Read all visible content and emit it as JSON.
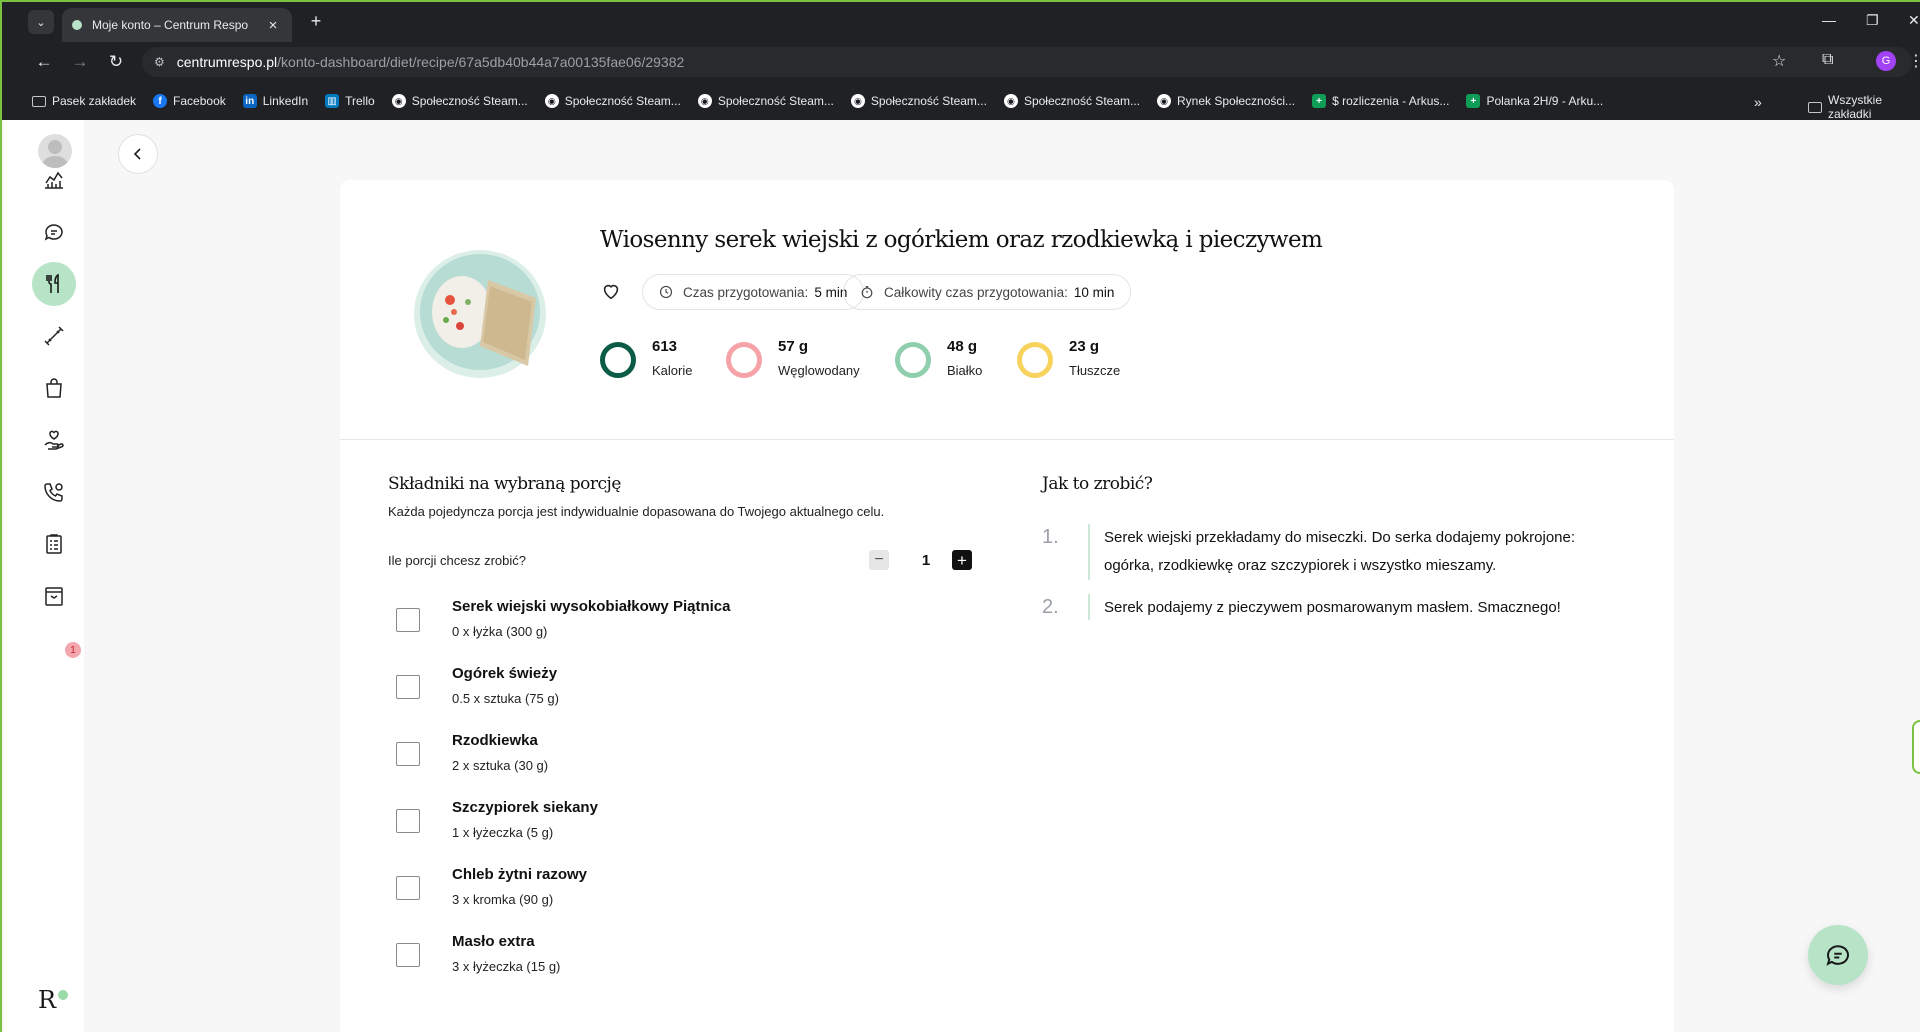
{
  "browser": {
    "tab_title": "Moje konto – Centrum Respo",
    "url_host": "centrumrespo.pl",
    "url_path": "/konto-dashboard/diet/recipe/67a5db40b44a7a00135fae06/29382",
    "profile_initial": "G",
    "bookmarks": [
      {
        "label": "Pasek zakładek",
        "icon": "folder-icon"
      },
      {
        "label": "Facebook",
        "icon": "facebook-icon"
      },
      {
        "label": "LinkedIn",
        "icon": "linkedin-icon"
      },
      {
        "label": "Trello",
        "icon": "trello-icon"
      },
      {
        "label": "Społeczność Steam...",
        "icon": "steam-icon"
      },
      {
        "label": "Społeczność Steam...",
        "icon": "steam-icon"
      },
      {
        "label": "Społeczność Steam...",
        "icon": "steam-icon"
      },
      {
        "label": "Społeczność Steam...",
        "icon": "steam-icon"
      },
      {
        "label": "Społeczność Steam...",
        "icon": "steam-icon"
      },
      {
        "label": "Rynek Społeczności...",
        "icon": "steam-icon"
      },
      {
        "label": "$ rozliczenia - Arkus...",
        "icon": "sheets-icon"
      },
      {
        "label": "Polanka 2H/9 - Arku...",
        "icon": "sheets-icon"
      }
    ],
    "all_bookmarks_label": "Wszystkie zakładki"
  },
  "sidebar": {
    "items": [
      "avatar",
      "stats-chart-icon",
      "chat-bubble-icon",
      "fork-knife-icon",
      "dumbbell-icon",
      "shopping-bag-icon",
      "hand-heart-icon",
      "phone-call-icon",
      "clipboard-icon",
      "archive-box-icon"
    ],
    "active": "fork-knife-icon",
    "badge_count": "1",
    "logo_text": "R"
  },
  "recipe": {
    "title": "Wiosenny serek wiejski z ogórkiem oraz rzodkiewką i pieczywem",
    "prep_time_label": "Czas przygotowania:",
    "prep_time_value": "5 min",
    "total_time_label": "Całkowity czas przygotowania:",
    "total_time_value": "10 min",
    "macros": [
      {
        "value": "613",
        "label": "Kalorie",
        "color": "#0b5c46"
      },
      {
        "value": "57 g",
        "label": "Węglowodany",
        "color": "#f5a3a8"
      },
      {
        "value": "48 g",
        "label": "Białko",
        "color": "#8fcfae"
      },
      {
        "value": "23 g",
        "label": "Tłuszcze",
        "color": "#f7d25c"
      }
    ]
  },
  "ingredients": {
    "heading": "Składniki na wybraną porcję",
    "subtitle": "Każda pojedyncza porcja jest indywidualnie dopasowana do Twojego aktualnego celu.",
    "portions_label": "Ile porcji chcesz zrobić?",
    "portions_value": "1",
    "items": [
      {
        "name": "Serek wiejski wysokobiałkowy Piątnica",
        "qty": "0 x łyżka (300 g)"
      },
      {
        "name": "Ogórek świeży",
        "qty": "0.5 x sztuka (75 g)"
      },
      {
        "name": "Rzodkiewka",
        "qty": "2 x sztuka (30 g)"
      },
      {
        "name": "Szczypiorek siekany",
        "qty": "1 x łyżeczka (5 g)"
      },
      {
        "name": "Chleb żytni razowy",
        "qty": "3 x kromka (90 g)"
      },
      {
        "name": "Masło extra",
        "qty": "3 x łyżeczka (15 g)"
      }
    ]
  },
  "instructions": {
    "heading": "Jak to zrobić?",
    "steps": [
      {
        "num": "1.",
        "text": "Serek wiejski przekładamy do miseczki. Do serka dodajemy pokrojone: ogórka, rzodkiewkę oraz szczypiorek i wszystko mieszamy."
      },
      {
        "num": "2.",
        "text": "Serek podajemy z pieczywem posmarowanym masłem. Smacznego!"
      }
    ]
  }
}
